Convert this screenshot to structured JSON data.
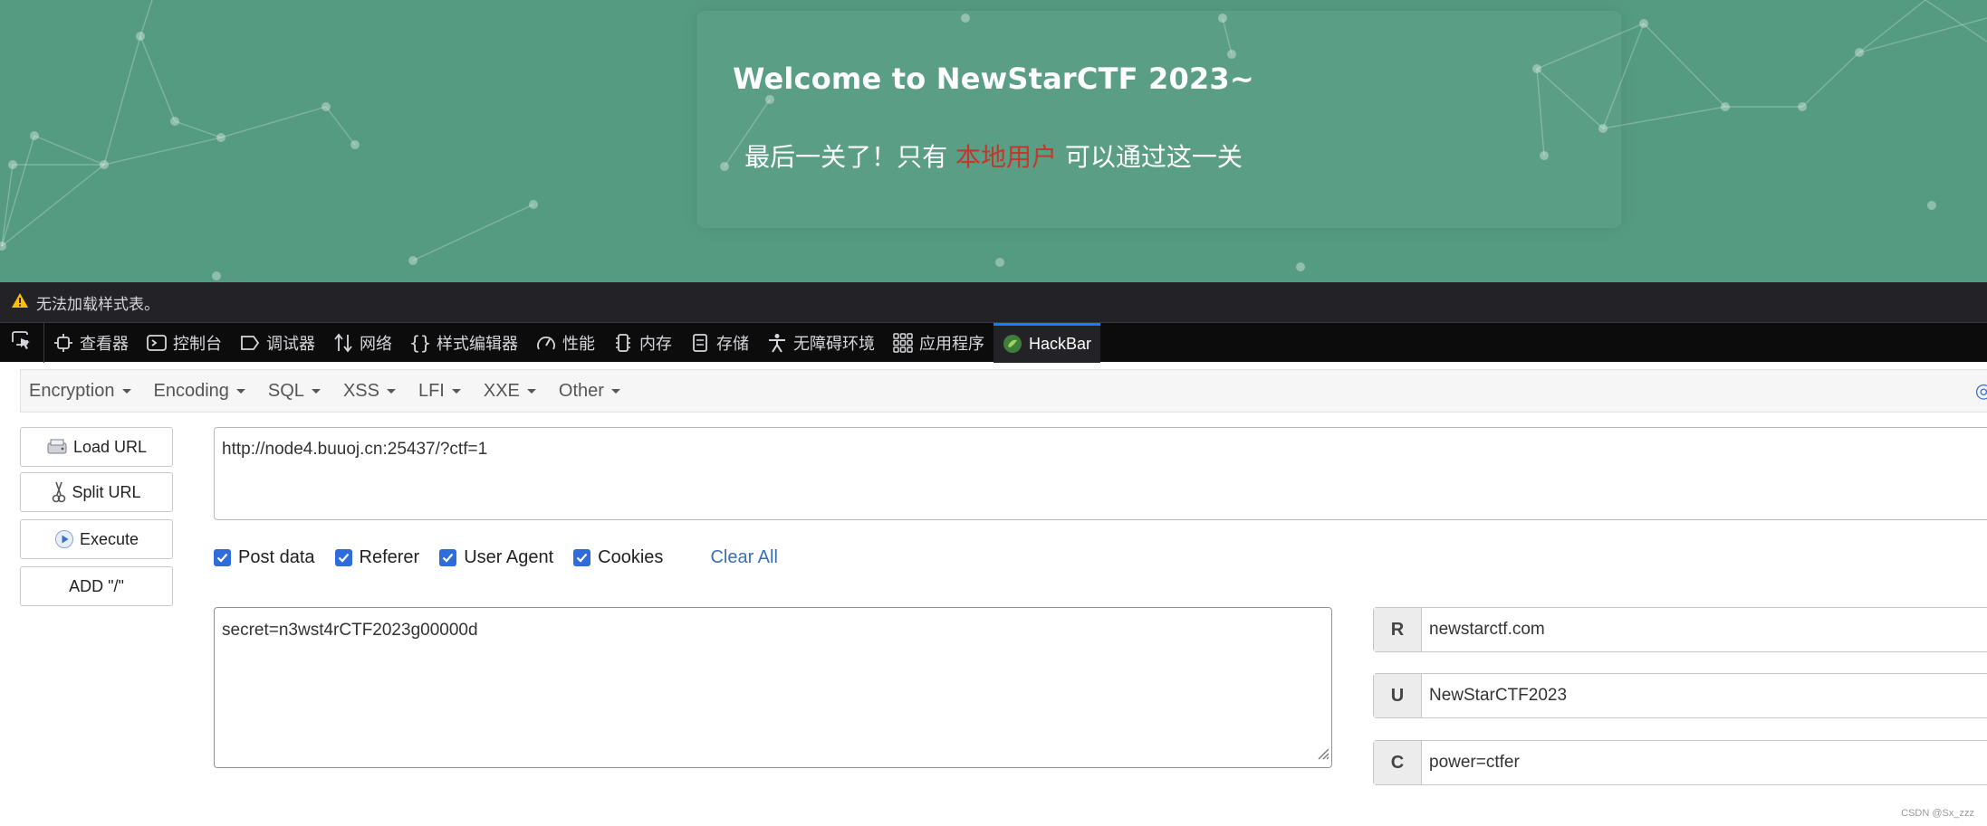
{
  "page": {
    "title": "Welcome to NewStarCTF 2023~",
    "subtitle_before": "最后一关了！只有",
    "subtitle_highlight": "本地用户",
    "subtitle_after": "可以通过这一关"
  },
  "notice": {
    "text": "无法加载样式表。",
    "icon": "warning-icon"
  },
  "devtools": {
    "tabs": [
      {
        "label": "查看器",
        "icon": "inspector-icon"
      },
      {
        "label": "控制台",
        "icon": "console-icon"
      },
      {
        "label": "调试器",
        "icon": "debugger-icon"
      },
      {
        "label": "网络",
        "icon": "network-icon"
      },
      {
        "label": "样式编辑器",
        "icon": "style-editor-icon"
      },
      {
        "label": "性能",
        "icon": "performance-icon"
      },
      {
        "label": "内存",
        "icon": "memory-icon"
      },
      {
        "label": "存储",
        "icon": "storage-icon"
      },
      {
        "label": "无障碍环境",
        "icon": "accessibility-icon"
      },
      {
        "label": "应用程序",
        "icon": "application-icon"
      },
      {
        "label": "HackBar",
        "icon": "hackbar-icon",
        "active": true
      }
    ]
  },
  "hackbar": {
    "menu": [
      "Encryption",
      "Encoding",
      "SQL",
      "XSS",
      "LFI",
      "XXE",
      "Other"
    ],
    "buttons": {
      "load_url": "Load URL",
      "split_url": "Split URL",
      "execute": "Execute",
      "add_slash": "ADD \"/\""
    },
    "url": "http://node4.buuoj.cn:25437/?ctf=1",
    "options": [
      {
        "label": "Post data",
        "checked": true
      },
      {
        "label": "Referer",
        "checked": true
      },
      {
        "label": "User Agent",
        "checked": true
      },
      {
        "label": "Cookies",
        "checked": true
      }
    ],
    "clear_all": "Clear All",
    "post_data": "secret=n3wst4rCTF2023g00000d",
    "headers": {
      "referer": {
        "key": "R",
        "value": "newstarctf.com"
      },
      "user_agent": {
        "key": "U",
        "value": "NewStarCTF2023"
      },
      "cookies": {
        "key": "C",
        "value": "power=ctfer"
      }
    }
  },
  "watermark": "CSDN @Sx_zzz",
  "colors": {
    "hero_bg": "#559b82",
    "highlight": "#c0392b",
    "accent": "#0a84ff",
    "checkbox": "#2e6bdb",
    "link": "#3b6fb6"
  }
}
